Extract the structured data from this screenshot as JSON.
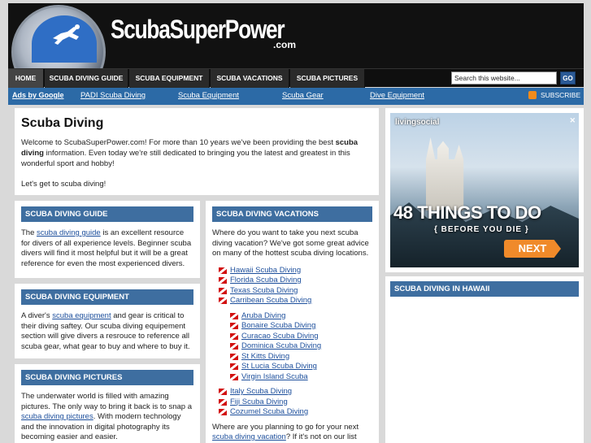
{
  "header": {
    "logo_text": "ScubaSuperPower",
    "logo_sub": ".com"
  },
  "nav": {
    "items": [
      {
        "label": "HOME"
      },
      {
        "label": "SCUBA DIVING GUIDE"
      },
      {
        "label": "SCUBA EQUIPMENT"
      },
      {
        "label": "SCUBA VACATIONS"
      },
      {
        "label": "SCUBA PICTURES"
      }
    ],
    "search_placeholder": "Search this website...",
    "search_button": "GO"
  },
  "adbar": {
    "title": "Ads by Google",
    "links": [
      "PADI Scuba Diving",
      "Scuba Equipment",
      "Scuba Gear",
      "Dive Equipment"
    ],
    "subscribe": "SUBSCRIBE"
  },
  "intro": {
    "title": "Scuba Diving",
    "p1_before": "Welcome to ScubaSuperPower.com! For more than 10 years we've been providing the best ",
    "p1_bold": "scuba diving",
    "p1_after": " information. Even today we're still dedicated to bringing you the latest and greatest in this wonderful sport and hobby!",
    "p2": "Let's get to scuba diving!"
  },
  "guide": {
    "title": "SCUBA DIVING GUIDE",
    "before": "The ",
    "link": "scuba diving guide",
    "after": " is an excellent resource for divers of all experience levels. Beginner scuba divers will find it most helpful but it will be a great reference for even the most experienced divers."
  },
  "equipment": {
    "title": "SCUBA DIVING EQUIPMENT",
    "before": "A diver's ",
    "link": "scuba equipment",
    "after": " and gear is critical to their diving saftey. Our scuba diving equipement section will give divers a resrouce to reference all scuba gear, what gear to buy and where to buy it."
  },
  "pictures": {
    "title": "SCUBA DIVING PICTURES",
    "before": "The underwater world is filled with amazing pictures. The only way to bring it back is to snap a ",
    "link": "scuba diving pictures",
    "after": ". With modern technology and the innovation in digital photography its becoming easier and easier."
  },
  "vacations": {
    "title": "SCUBA DIVING VACATIONS",
    "intro": "Where do you want to take you next scuba diving vacation? We've got some great advice on many of the hottest scuba diving locations.",
    "list": [
      {
        "label": "Hawaii Scuba Diving"
      },
      {
        "label": "Florida Scuba Diving"
      },
      {
        "label": "Texas Scuba Diving"
      },
      {
        "label": "Carribean Scuba Diving"
      }
    ],
    "sublist": [
      {
        "label": "Aruba Diving"
      },
      {
        "label": "Bonaire Scuba Diving"
      },
      {
        "label": "Curacao Scuba Diving"
      },
      {
        "label": "Dominica Scuba Diving"
      },
      {
        "label": "St Kitts Diving"
      },
      {
        "label": "St Lucia Scuba Diving"
      },
      {
        "label": "Virgin Island Scuba"
      }
    ],
    "list2": [
      {
        "label": "Italy Scuba Diving"
      },
      {
        "label": "Fiji Scuba Diving"
      },
      {
        "label": "Cozumel Scuba Diving"
      }
    ],
    "outro_before": "Where are you planning to go for your next ",
    "outro_link": "scuba diving vacation",
    "outro_after": "? If it's not on our list write as a review!"
  },
  "ad": {
    "brand": "livingsocial",
    "headline": "48 THINGS TO DO",
    "sub": "{ BEFORE YOU DIE }",
    "next": "NEXT",
    "close": "✕"
  },
  "hawaii": {
    "title": "SCUBA DIVING IN HAWAII"
  }
}
